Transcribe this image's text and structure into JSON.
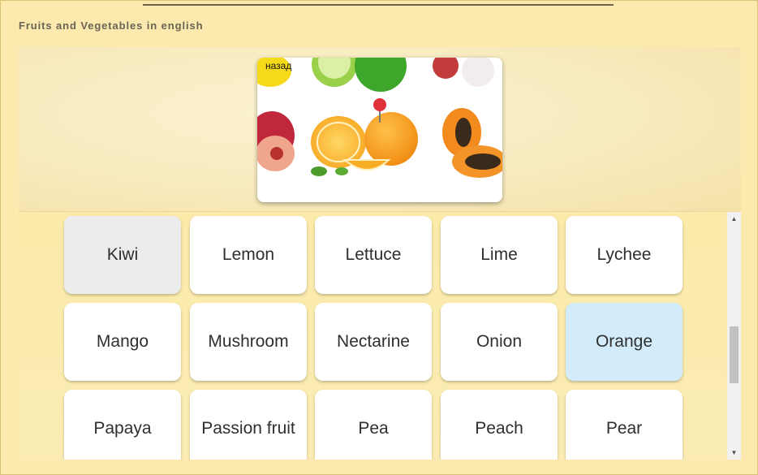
{
  "app": {
    "title": "Fruits and Vegetables in english"
  },
  "image_card": {
    "back_label": "назад",
    "image_subject": "orange"
  },
  "tiles": [
    {
      "label": "Kiwi",
      "state": "pressed"
    },
    {
      "label": "Lemon",
      "state": "normal"
    },
    {
      "label": "Lettuce",
      "state": "normal"
    },
    {
      "label": "Lime",
      "state": "normal"
    },
    {
      "label": "Lychee",
      "state": "normal"
    },
    {
      "label": "Mango",
      "state": "normal"
    },
    {
      "label": "Mushroom",
      "state": "normal"
    },
    {
      "label": "Nectarine",
      "state": "normal"
    },
    {
      "label": "Onion",
      "state": "normal"
    },
    {
      "label": "Orange",
      "state": "selected"
    },
    {
      "label": "Papaya",
      "state": "normal"
    },
    {
      "label": "Passion fruit",
      "state": "normal"
    },
    {
      "label": "Pea",
      "state": "normal"
    },
    {
      "label": "Peach",
      "state": "normal"
    },
    {
      "label": "Pear",
      "state": "normal"
    }
  ],
  "colors": {
    "background": "#fbe9ad",
    "selected_tile": "#d2ecfb",
    "pressed_tile": "#ececec"
  }
}
